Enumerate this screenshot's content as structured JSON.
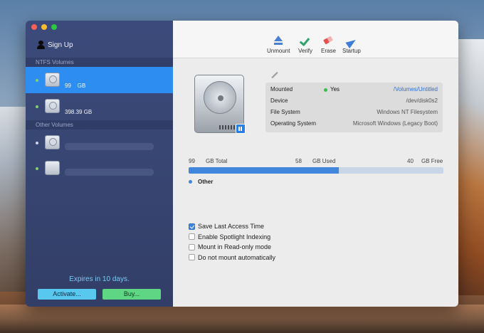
{
  "sidebar": {
    "signup_label": "Sign Up",
    "ntfs_header": "NTFS Volumes",
    "other_header": "Other Volumes",
    "volumes": [
      {
        "size": "99",
        "unit": "GB",
        "selected": true,
        "dot_color": "#7dd36b"
      },
      {
        "size": "398.39 GB",
        "selected": false,
        "dot_color": "#7dd36b"
      },
      {
        "size": "",
        "selected": false,
        "dot_color": "#cfd6e6"
      },
      {
        "size": "",
        "selected": false,
        "dot_color": "#7dd36b"
      }
    ],
    "expires": "Expires in 10 days.",
    "activate_label": "Activate...",
    "buy_label": "Buy..."
  },
  "toolbar": {
    "unmount": "Unmount",
    "verify": "Verify",
    "erase": "Erase",
    "startup": "Startup"
  },
  "info": {
    "mounted_key": "Mounted",
    "mounted_value": "Yes",
    "mount_path": "/Volumes/Untitled",
    "device_key": "Device",
    "device_value": "/dev/disk0s2",
    "fs_key": "File System",
    "fs_value": "Windows NT Filesystem",
    "os_key": "Operating System",
    "os_value": "Microsoft Windows (Legacy Boot)"
  },
  "usage": {
    "total_num": "99",
    "total_label": "GB Total",
    "used_num": "58",
    "used_label": "GB Used",
    "free_num": "40",
    "free_label": "GB Free",
    "used_fraction": 0.59,
    "legend_other": "Other"
  },
  "options": [
    {
      "label": "Save Last Access Time",
      "checked": true
    },
    {
      "label": "Enable Spotlight Indexing",
      "checked": false
    },
    {
      "label": "Mount in Read-only mode",
      "checked": false
    },
    {
      "label": "Do not mount automatically",
      "checked": false
    }
  ],
  "colors": {
    "accent": "#2d8df0",
    "activate": "#58c8ef",
    "buy": "#5fd683",
    "expires_text": "#7cc8f4"
  }
}
